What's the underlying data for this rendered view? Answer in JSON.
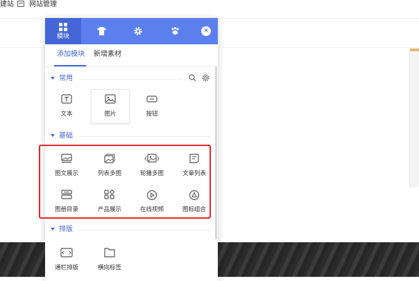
{
  "topbar": {
    "left_text": "建站",
    "manage_label": "网站管理"
  },
  "panel": {
    "tabs": [
      {
        "label": "模块",
        "icon": "grid-icon",
        "active": true
      },
      {
        "label": "",
        "icon": "shirt-icon"
      },
      {
        "label": "",
        "icon": "gear-icon"
      },
      {
        "label": "",
        "icon": "paw-icon"
      }
    ],
    "close_icon": "close-icon",
    "subtabs": [
      {
        "label": "添加模块",
        "active": true
      },
      {
        "label": "新增素材"
      }
    ],
    "sections": [
      {
        "title": "常用",
        "items": [
          {
            "label": "文本",
            "icon": "text-icon"
          },
          {
            "label": "图片",
            "icon": "image-icon",
            "selected": true
          },
          {
            "label": "按钮",
            "icon": "button-icon"
          }
        ]
      },
      {
        "title": "基础",
        "items": [
          {
            "label": "图文展示",
            "icon": "image-text-icon"
          },
          {
            "label": "列表多图",
            "icon": "multi-image-icon"
          },
          {
            "label": "轮播多图",
            "icon": "carousel-icon"
          },
          {
            "label": "文章列表",
            "icon": "article-list-icon"
          },
          {
            "label": "图册目录",
            "icon": "album-icon"
          },
          {
            "label": "产品展示",
            "icon": "product-icon"
          },
          {
            "label": "在线视频",
            "icon": "video-icon"
          },
          {
            "label": "图标组合",
            "icon": "icon-group-icon"
          }
        ]
      },
      {
        "title": "排版",
        "items": [
          {
            "label": "通栏排版",
            "icon": "fullwidth-icon"
          },
          {
            "label": "横向标签",
            "icon": "tabs-icon"
          }
        ]
      }
    ],
    "tools": [
      "search-icon",
      "settings-icon"
    ]
  },
  "colors": {
    "accent": "#5b80ee",
    "highlight": "#e02626"
  }
}
